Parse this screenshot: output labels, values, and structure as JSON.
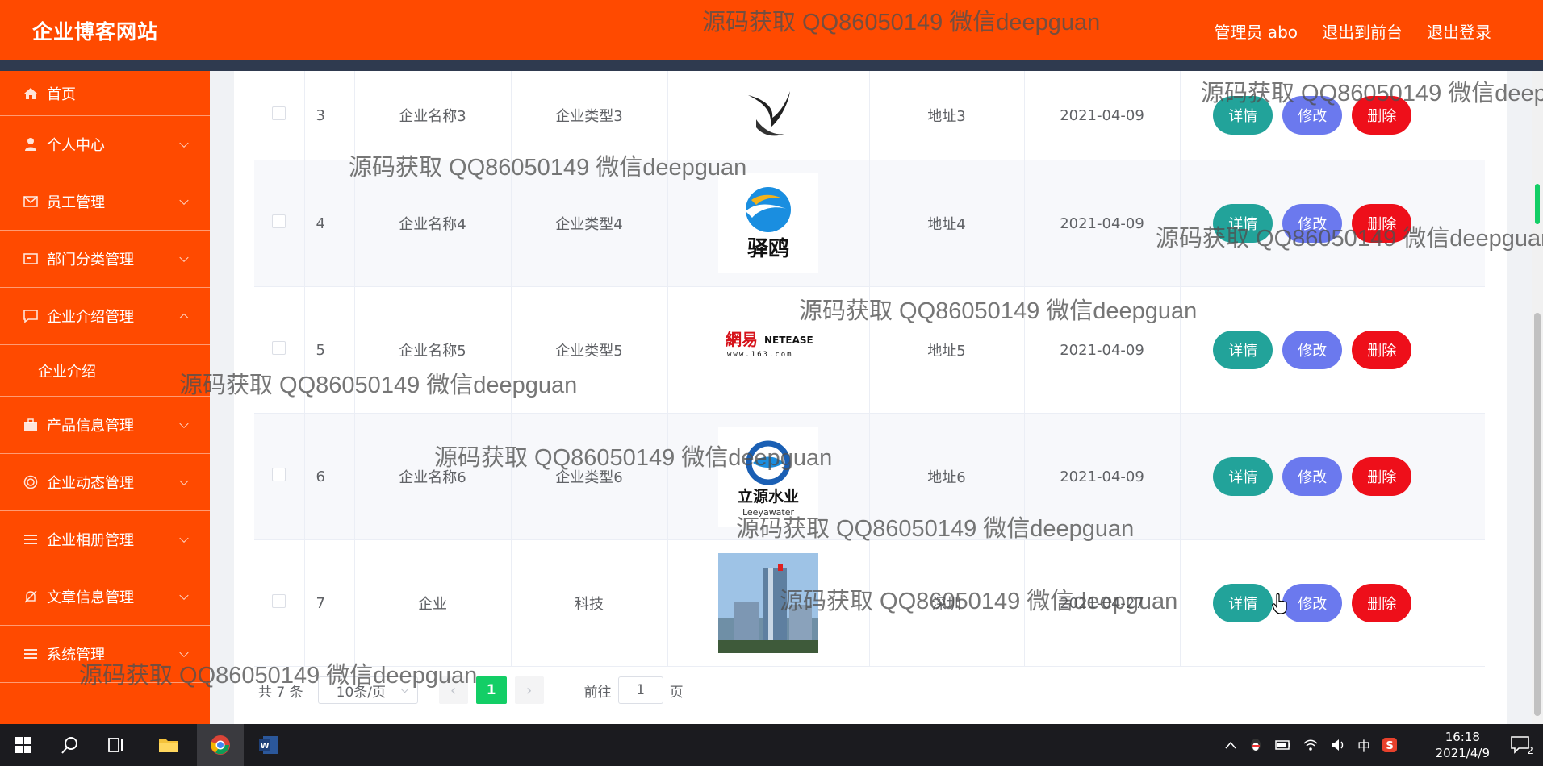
{
  "header": {
    "brand": "企业博客网站",
    "admin": "管理员 abo",
    "back_front": "退出到前台",
    "logout": "退出登录"
  },
  "sidebar": {
    "items": [
      {
        "label": "首页",
        "icon": "home-icon"
      },
      {
        "label": "个人中心",
        "icon": "user-icon"
      },
      {
        "label": "员工管理",
        "icon": "mail-icon"
      },
      {
        "label": "部门分类管理",
        "icon": "card-icon"
      },
      {
        "label": "企业介绍管理",
        "icon": "message-icon"
      },
      {
        "label": "产品信息管理",
        "icon": "briefcase-icon"
      },
      {
        "label": "企业动态管理",
        "icon": "target-icon"
      },
      {
        "label": "企业相册管理",
        "icon": "list-icon"
      },
      {
        "label": "文章信息管理",
        "icon": "bell-off-icon"
      },
      {
        "label": "系统管理",
        "icon": "list-icon"
      }
    ],
    "submenu": "企业介绍"
  },
  "table": {
    "rows": [
      {
        "idx": "3",
        "name": "企业名称3",
        "type": "企业类型3",
        "addr": "地址3",
        "date": "2021-04-09",
        "logo": "bird-logo"
      },
      {
        "idx": "4",
        "name": "企业名称4",
        "type": "企业类型4",
        "addr": "地址4",
        "date": "2021-04-09",
        "logo": "yizhan-logo"
      },
      {
        "idx": "5",
        "name": "企业名称5",
        "type": "企业类型5",
        "addr": "地址5",
        "date": "2021-04-09",
        "logo": "netease-logo"
      },
      {
        "idx": "6",
        "name": "企业名称6",
        "type": "企业类型6",
        "addr": "地址6",
        "date": "2021-04-09",
        "logo": "leeyawater-logo"
      },
      {
        "idx": "7",
        "name": "企业",
        "type": "科技",
        "addr": "深圳",
        "date": "2021-04-27",
        "logo": "building-photo"
      }
    ],
    "ops": {
      "detail": "详情",
      "edit": "修改",
      "delete": "删除"
    }
  },
  "logos": {
    "yizhan_text": "驿鸥",
    "netease_cn": "網易",
    "netease_en": "NETEASE",
    "netease_url": "www.163.com",
    "leeya_cn": "立源水业",
    "leeya_en": "Leeyawater"
  },
  "pagination": {
    "total": "共 7 条",
    "page_size": "10条/页",
    "current": "1",
    "goto_label": "前往",
    "goto_value": "1",
    "page_unit": "页"
  },
  "watermark": "源码获取 QQ86050149 微信deepguan",
  "taskbar": {
    "time": "16:18",
    "date": "2021/4/9",
    "ime": "中",
    "notif_count": "2"
  },
  "colors": {
    "brand": "#ff4a00",
    "detail": "#22a39a",
    "edit": "#6b79ee",
    "delete": "#ee0f1a",
    "page_active": "#13ce66"
  }
}
